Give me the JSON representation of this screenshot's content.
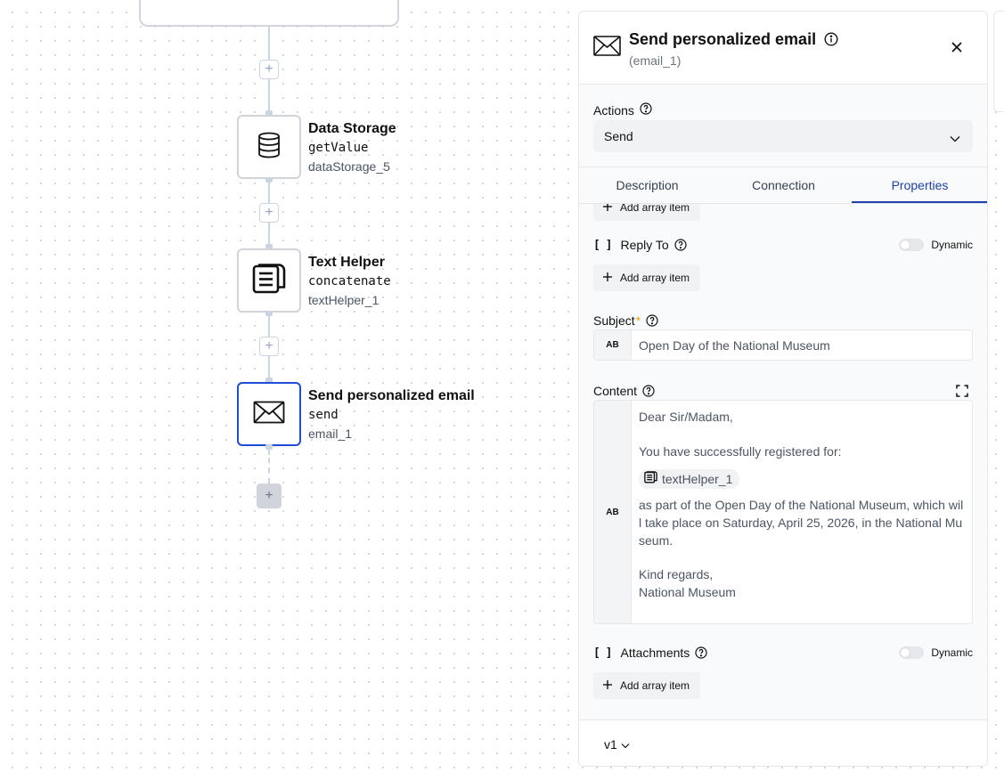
{
  "canvas": {
    "nodes": [
      {
        "title": "Data Storage",
        "method": "getValue",
        "id": "dataStorage_5",
        "icon": "database-icon"
      },
      {
        "title": "Text Helper",
        "method": "concatenate",
        "id": "textHelper_1",
        "icon": "text-helper-icon"
      },
      {
        "title": "Send personalized email",
        "method": "send",
        "id": "email_1",
        "icon": "envelope-icon",
        "selected": true
      }
    ],
    "add_symbol": "+"
  },
  "panel": {
    "title": "Send personalized email",
    "subtitle": "(email_1)",
    "actions_label": "Actions",
    "actions_value": "Send",
    "tabs": [
      "Description",
      "Connection",
      "Properties"
    ],
    "active_tab": "Properties",
    "add_array_item_label": "Add array item",
    "reply_to_label": "Reply To",
    "dynamic_label": "Dynamic",
    "subject_label": "Subject",
    "subject_required_mark": "*",
    "subject_value": "Open Day of the National Museum",
    "ab_label": "AB",
    "content_label": "Content",
    "content": {
      "line1": "Dear Sir/Madam,",
      "line2": "You have successfully registered for:",
      "chip": "textHelper_1",
      "line3": "as part of the Open Day of the National Museum, which will take place on Saturday, April 25, 2026, in the National Museum.",
      "line4": "Kind regards,",
      "line5": "National Museum"
    },
    "attachments_label": "Attachments",
    "bracket_symbol": "[ ]",
    "version": "v1"
  },
  "colors": {
    "accent": "#1e40af",
    "selected_border": "#1d4ed8",
    "required": "#f59e0b"
  }
}
